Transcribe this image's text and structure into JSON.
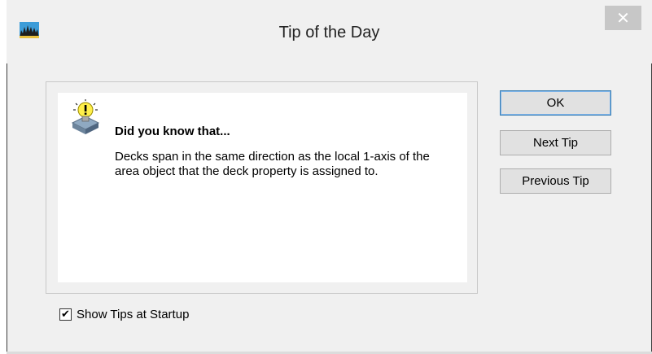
{
  "window": {
    "title": "Tip of the Day",
    "app_icon": "app-logo-icon",
    "close_glyph": "✕"
  },
  "tip": {
    "icon": "lightbulb-icon",
    "heading": "Did you know that...",
    "body": "Decks span in the same direction as the local 1-axis of the area object that the deck property is assigned to."
  },
  "buttons": {
    "ok_label": "OK",
    "next_label": "Next Tip",
    "previous_label": "Previous Tip"
  },
  "options": {
    "show_tips_label": "Show Tips at Startup",
    "show_tips_checked": true,
    "check_glyph": "✔"
  },
  "colors": {
    "dialog_bg": "#f0f0f0",
    "close_button_bg": "#c7c7c7",
    "default_button_border": "#3c7fb1"
  }
}
